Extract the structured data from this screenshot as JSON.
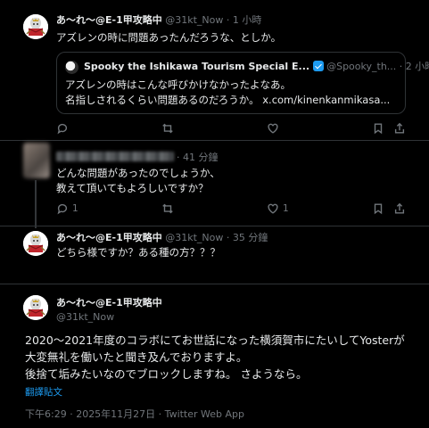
{
  "posts": [
    {
      "name": "あ～れ～@E-1甲攻略中",
      "handle": "@31kt_Now",
      "dot": "·",
      "time": "1 小時",
      "text": "アズレンの時に問題あったんだろうな、としか。",
      "quote": {
        "name": "Spooky the Ishikawa Tourism Special E...",
        "handle": "@Spooky_th...",
        "time": "· 2 小時",
        "lines": [
          "アズレンの時はこんな呼びかけなかったよなあ。",
          "名指しされるくらい問題あるのだろうか。 x.com/kinenkanmikasa..."
        ]
      }
    },
    {
      "time": "· 41 分鐘",
      "lines": [
        "どんな問題があったのでしょうか、",
        "教えて頂いてもよろしいですか？"
      ],
      "reply_count": "1",
      "like_count": "1"
    },
    {
      "name": "あ～れ～@E-1甲攻略中",
      "handle": "@31kt_Now",
      "dot": "·",
      "time": "35 分鐘",
      "text": "どちら様ですか？ある種の方？？？"
    },
    {
      "name": "あ～れ～@E-1甲攻略中",
      "handle": "@31kt_Now",
      "lines": [
        "2020～2021年度のコラボにてお世話になった横須賀市にたいしてYosterが",
        "大変無礼を働いたと聞き及んでおりますよ。",
        "後捨て垢みたいなのでブロックしますね。 さようなら。"
      ],
      "translate": "翻譯貼文",
      "meta": "下午6:29 · 2025年11月27日 · Twitter Web App"
    }
  ],
  "icons": [
    "reply-icon",
    "retweet-icon",
    "like-icon",
    "bookmark-icon",
    "share-icon",
    "verified-badge-icon"
  ],
  "colors": {
    "background": "#000000",
    "text": "#e7e9ea",
    "muted": "#71767b",
    "accent": "#1d9bf0",
    "border": "#2f3336"
  }
}
